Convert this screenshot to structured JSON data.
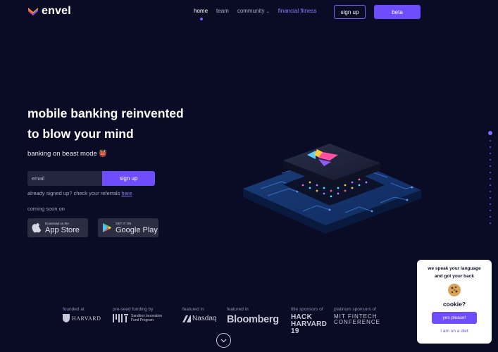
{
  "brand": {
    "name": "envel"
  },
  "nav": {
    "items": [
      {
        "label": "home"
      },
      {
        "label": "team"
      },
      {
        "label": "community"
      },
      {
        "label": "financial fitness"
      }
    ],
    "signup_label": "sign up",
    "beta_label": "beta"
  },
  "hero": {
    "title_line1": "mobile banking reinvented",
    "title_line2": "to blow your mind",
    "tagline": "banking on beast mode 👹",
    "email_placeholder": "email",
    "signup_button": "sign up",
    "referrals_text": "already signed up? check your referrals ",
    "referrals_link": "here",
    "coming_soon": "coming soon on"
  },
  "stores": {
    "apple": {
      "small": "Download on the",
      "big": "App Store"
    },
    "google": {
      "small": "GET IT ON",
      "big": "Google Play"
    }
  },
  "sponsors": [
    {
      "caption": "founded at",
      "mark": "HARVARD"
    },
    {
      "caption": "pre-seed funding by",
      "mark": "Sandbox Innovation Fund Program"
    },
    {
      "caption": "featured in",
      "mark": "Nasdaq"
    },
    {
      "caption": "featured in",
      "mark": "Bloomberg"
    },
    {
      "caption": "title sponsors of",
      "mark": "HACK HARVARD 19"
    },
    {
      "caption": "platinum sponsors of",
      "mark": "MIT FINTECH CONFERENCE"
    }
  ],
  "cookie": {
    "line1": "we speak your language",
    "line2": "and got your back",
    "question": "cookie?",
    "accept": "yes please!",
    "decline": "I am on a diet"
  },
  "colors": {
    "background": "#0a0b24",
    "accent": "#6d4dff",
    "link": "#8d7dff"
  }
}
